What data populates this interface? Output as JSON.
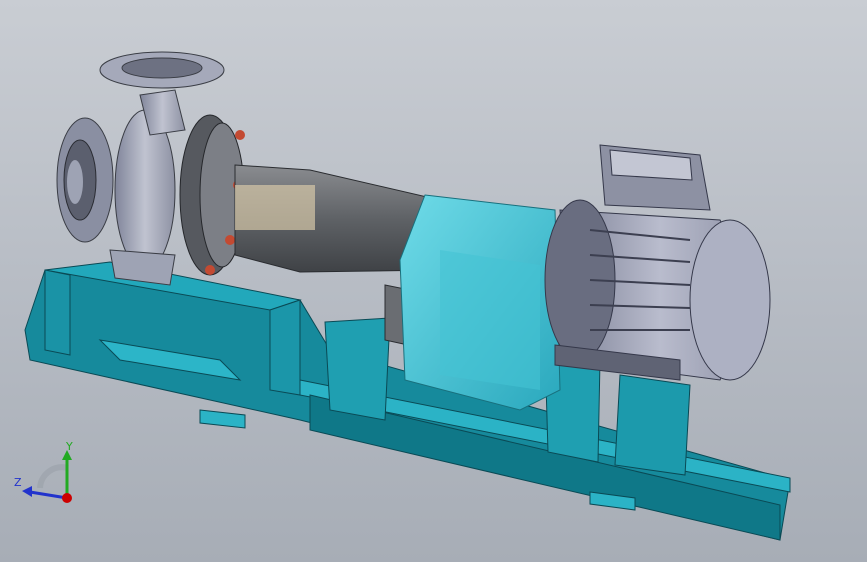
{
  "viewport": {
    "background_top": "#c9cdd3",
    "background_bottom": "#a7adb6"
  },
  "model": {
    "parts": [
      "baseplate-frame",
      "pump-casing",
      "suction-flange",
      "discharge-flange",
      "bearing-bracket",
      "coupling-guard",
      "electric-motor",
      "terminal-box"
    ],
    "colors": {
      "baseplate": "#1e9aae",
      "pump_metal": "#9ea3b4",
      "motor_metal": "#a9adc0",
      "guard": "#5fd0e0",
      "bracket": "#6a6d72"
    }
  },
  "triad": {
    "x_label": "",
    "y_label": "Y",
    "z_label": "Z",
    "x_color": "#cc0000",
    "y_color": "#22aa22",
    "z_color": "#2233cc"
  }
}
